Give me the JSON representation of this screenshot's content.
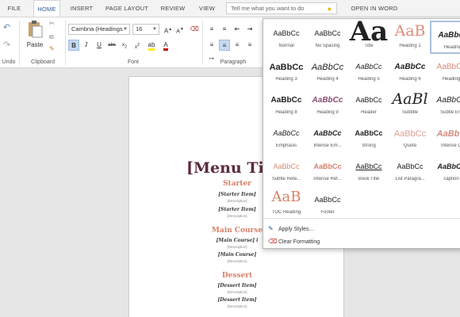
{
  "tabs": [
    {
      "label": "FILE"
    },
    {
      "label": "HOME"
    },
    {
      "label": "INSERT"
    },
    {
      "label": "PAGE LAYOUT"
    },
    {
      "label": "REVIEW"
    },
    {
      "label": "VIEW"
    },
    {
      "label": "OPEN IN WORD"
    }
  ],
  "tell_me": {
    "placeholder": "Tell me what you want to do"
  },
  "ribbon": {
    "groups": {
      "undo": "Undo",
      "clipboard": "Clipboard",
      "font": "Font",
      "paragraph": "Paragraph"
    },
    "paste_label": "Paste",
    "font_name": "Cambria (Headings",
    "font_size": "16"
  },
  "document": {
    "title": "[Menu Tit",
    "sections": [
      {
        "heading": "Starter",
        "items": [
          "[Starter Item]",
          "[Starter Item]"
        ],
        "desc": "[Description]"
      },
      {
        "heading": "Main Course",
        "items": [
          "[Main Course] i",
          "[Main Course]"
        ],
        "desc": "[Description]"
      },
      {
        "heading": "Dessert",
        "items": [
          "[Dessert Item]",
          "[Dessert Item]"
        ],
        "desc": "[Description]"
      }
    ]
  },
  "styles": [
    {
      "preview": "AaBbCc",
      "name": "Normal"
    },
    {
      "preview": "AaBbCc",
      "name": "No Spacing"
    },
    {
      "preview": "Aa",
      "name": "Title"
    },
    {
      "preview": "AaB",
      "name": "Heading 1"
    },
    {
      "preview": "AaBbcc",
      "name": "Heading"
    },
    {
      "preview": "AaBbCc",
      "name": "Heading 3"
    },
    {
      "preview": "AaBbCc",
      "name": "Heading 4"
    },
    {
      "preview": "AaBbCc",
      "name": "Heading 5"
    },
    {
      "preview": "AaBbCc",
      "name": "Heading 6"
    },
    {
      "preview": "AaBbCc",
      "name": "Heading"
    },
    {
      "preview": "AaBbCc",
      "name": "Heading 8"
    },
    {
      "preview": "AaBbCc",
      "name": "Heading 9"
    },
    {
      "preview": "AaBbCc",
      "name": "Header"
    },
    {
      "preview": "AaBl",
      "name": "Subtitle"
    },
    {
      "preview": "AaBbCc",
      "name": "Subtle Em"
    },
    {
      "preview": "AaBbCc",
      "name": "Emphasis"
    },
    {
      "preview": "AaBbCc",
      "name": "Intense Em..."
    },
    {
      "preview": "AaBbCc",
      "name": "Strong"
    },
    {
      "preview": "AaBbCc",
      "name": "Quote"
    },
    {
      "preview": "AaBbC",
      "name": "Intense Q"
    },
    {
      "preview": "AaBbCc",
      "name": "Subtle Refe..."
    },
    {
      "preview": "AaBbCc",
      "name": "Intense Ref..."
    },
    {
      "preview": "AaBbCc",
      "name": "Book Title"
    },
    {
      "preview": "AaBbCc",
      "name": "List Paragra..."
    },
    {
      "preview": "AaBbCc",
      "name": "caption"
    },
    {
      "preview": "AaB",
      "name": "TOC Heading"
    },
    {
      "preview": "AaBbCc",
      "name": "Footer"
    }
  ],
  "menu": {
    "apply_styles": "Apply Styles...",
    "clear_formatting": "Clear Formatting"
  },
  "colors": {
    "accent": "#2b579a",
    "heading": "#d9806a",
    "title": "#5b2a3c"
  }
}
